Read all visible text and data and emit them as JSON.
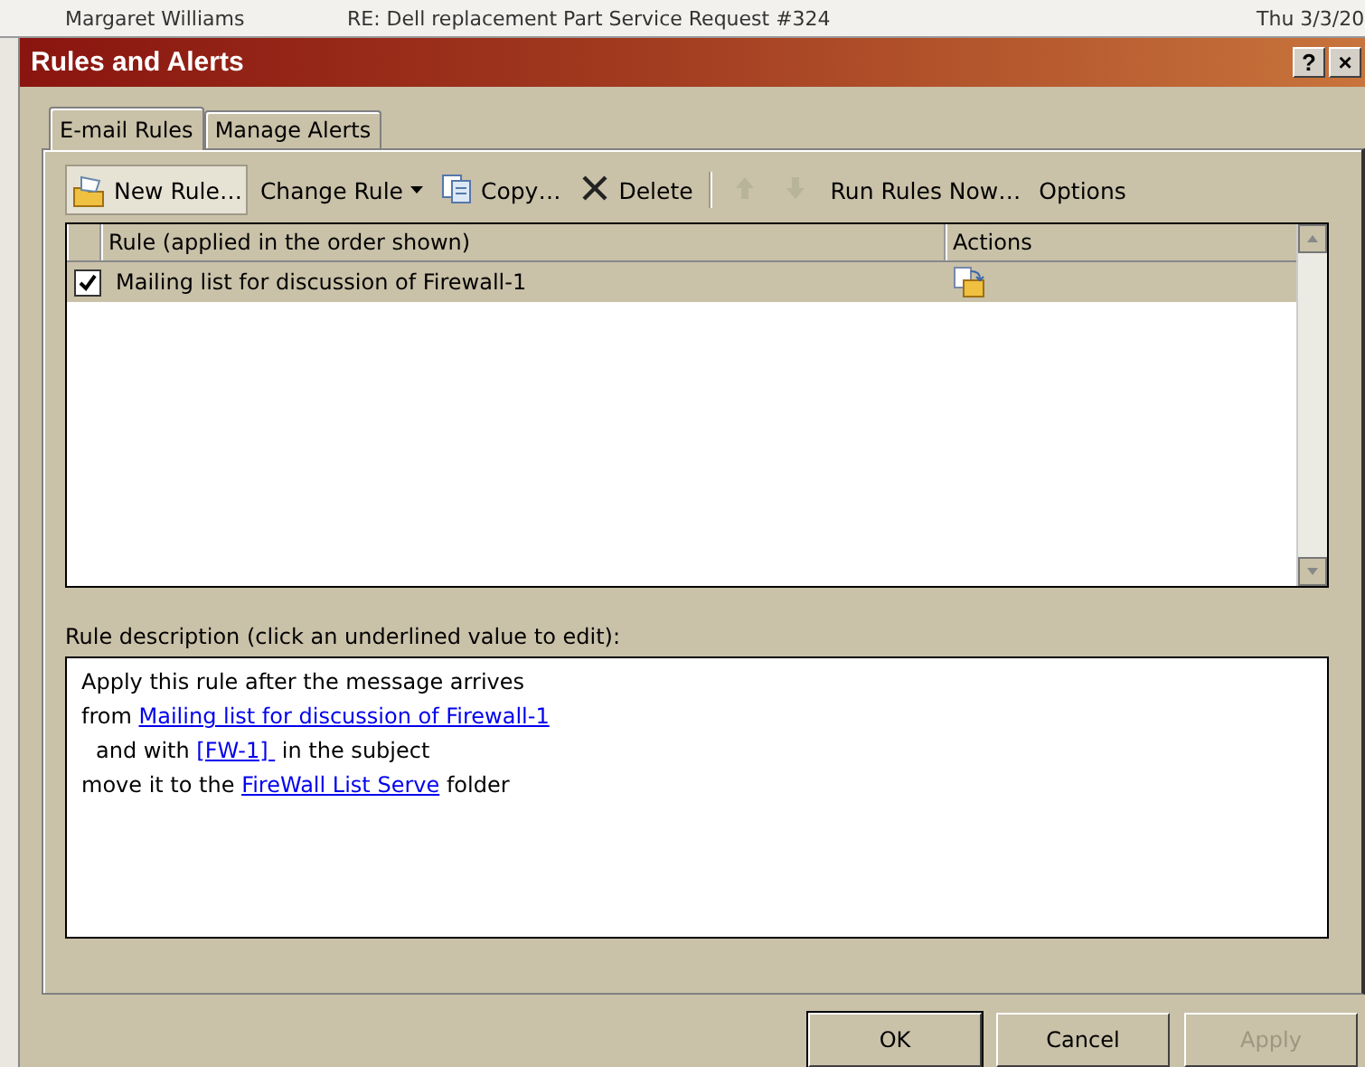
{
  "background_row": {
    "sender": "Margaret Williams",
    "subject": "RE: Dell replacement Part Service Request #324",
    "date": "Thu 3/3/20"
  },
  "window": {
    "title": "Rules and Alerts",
    "title_buttons": [
      "?",
      "×"
    ]
  },
  "tabs": [
    {
      "label": "E-mail Rules",
      "selected": true
    },
    {
      "label": "Manage Alerts",
      "selected": false
    }
  ],
  "toolbar": [
    {
      "kind": "button",
      "label": "New Rule…",
      "selected": true
    },
    {
      "kind": "button",
      "label": "Change Rule",
      "dropdown": true,
      "selected": false
    },
    {
      "kind": "button",
      "label": "Copy…",
      "selected": false
    },
    {
      "kind": "button",
      "label": "Delete",
      "selected": false
    },
    {
      "kind": "separator"
    },
    {
      "kind": "button",
      "selected": false,
      "disabled": true
    },
    {
      "kind": "button",
      "selected": false,
      "disabled": true
    },
    {
      "kind": "button",
      "label": "Run Rules Now…",
      "selected": false
    },
    {
      "kind": "button",
      "label": "Options",
      "selected": false
    }
  ],
  "rules_table": {
    "columns": [
      "Rule (applied in the order shown)",
      "Actions"
    ],
    "rows": [
      {
        "name": "Mailing list for discussion of Firewall-1",
        "checked": true,
        "selected": true
      }
    ]
  },
  "description": {
    "label": "Rule description (click an underlined value to edit):",
    "lines": [
      {
        "indent": false,
        "parts": [
          {
            "text": "Apply this rule after the message arrives",
            "link": false
          }
        ]
      },
      {
        "indent": false,
        "parts": [
          {
            "text": "from ",
            "link": false
          },
          {
            "text": "Mailing list for discussion of Firewall-1",
            "link": true
          }
        ]
      },
      {
        "indent": true,
        "parts": [
          {
            "text": "and with ",
            "link": false
          },
          {
            "text": "[FW-1] ",
            "link": true
          },
          {
            "text": " in the subject",
            "link": false
          }
        ]
      },
      {
        "indent": false,
        "parts": [
          {
            "text": "move it to the ",
            "link": false
          },
          {
            "text": "FireWall List Serve",
            "link": true
          },
          {
            "text": " folder",
            "link": false
          }
        ]
      }
    ]
  },
  "buttons": [
    {
      "label": "OK",
      "default": true,
      "disabled": false
    },
    {
      "label": "Cancel",
      "default": false,
      "disabled": false
    },
    {
      "label": "Apply",
      "default": false,
      "disabled": true
    }
  ]
}
